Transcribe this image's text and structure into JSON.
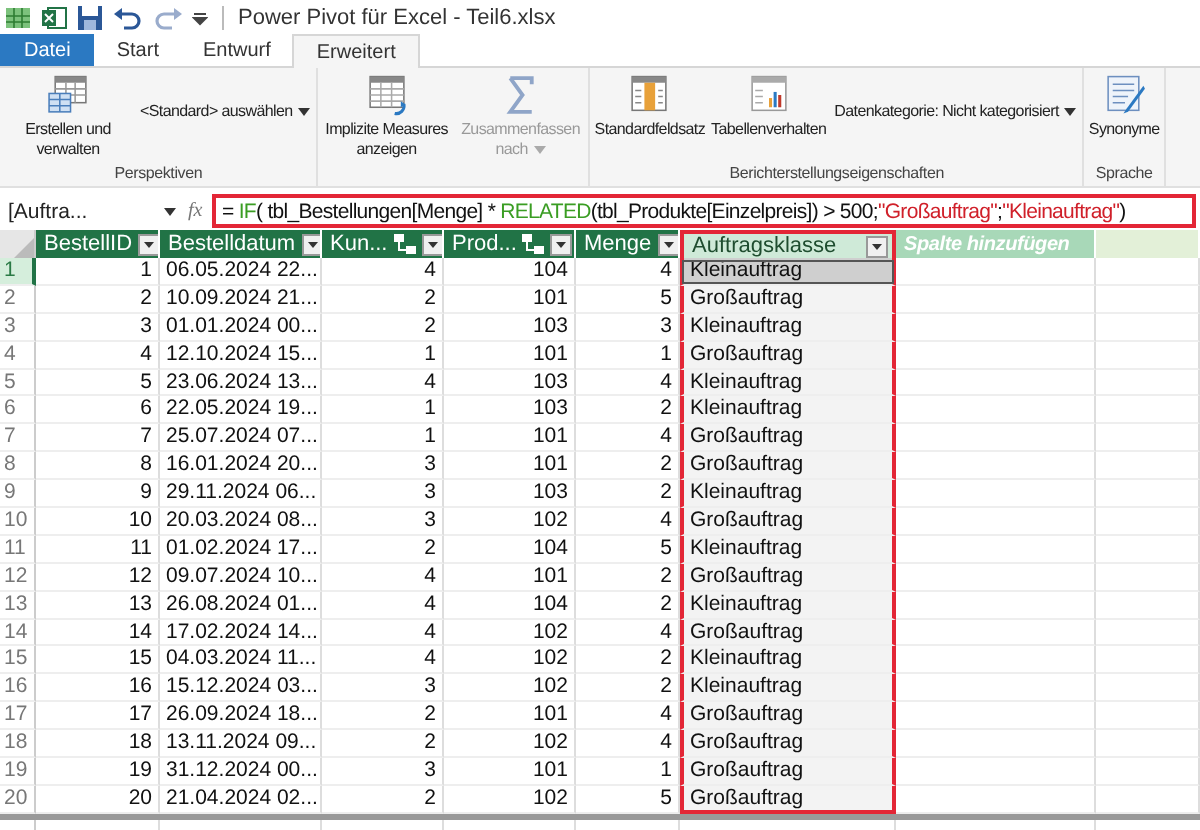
{
  "window": {
    "title": "Power Pivot für Excel - Teil6.xlsx"
  },
  "tabs": [
    {
      "label": "Datei",
      "kind": "file",
      "selected": false
    },
    {
      "label": "Start",
      "kind": "normal",
      "selected": false
    },
    {
      "label": "Entwurf",
      "kind": "normal",
      "selected": false
    },
    {
      "label": "Erweitert",
      "kind": "normal",
      "selected": true
    }
  ],
  "ribbon": {
    "groups": [
      {
        "title": "Perspektiven",
        "items": [
          {
            "kind": "large",
            "label": "Erstellen und verwalten",
            "disabled": false
          },
          {
            "kind": "dropdown",
            "label": "<Standard> auswählen"
          }
        ]
      },
      {
        "items": [
          {
            "kind": "large",
            "label": "Implizite Measures anzeigen",
            "disabled": false
          },
          {
            "kind": "large",
            "label": "Zusammenfassen nach",
            "disabled": true,
            "dropdown": true
          }
        ]
      },
      {
        "title": "Berichterstellungseigenschaften",
        "items": [
          {
            "kind": "large",
            "label": "Standardfeldsatz",
            "disabled": false
          },
          {
            "kind": "large",
            "label": "Tabellenverhalten",
            "disabled": false
          },
          {
            "kind": "dropdown",
            "label": "Datenkategorie: Nicht kategorisiert"
          }
        ]
      },
      {
        "title": "Sprache",
        "items": [
          {
            "kind": "large",
            "label": "Synonyme",
            "disabled": false
          }
        ]
      }
    ]
  },
  "formula_bar": {
    "name_box": "[Auftra...",
    "fx": "fx",
    "highlighted": true,
    "tokens": [
      {
        "text": "= ",
        "kind": "plain"
      },
      {
        "text": "IF",
        "kind": "function"
      },
      {
        "text": "( tbl_Bestellungen[Menge] * ",
        "kind": "plain"
      },
      {
        "text": "RELATED",
        "kind": "function"
      },
      {
        "text": "(tbl_Produkte[Einzelpreis]) > 500;",
        "kind": "plain"
      },
      {
        "text": "\"Großauftrag\"",
        "kind": "string"
      },
      {
        "text": ";",
        "kind": "plain"
      },
      {
        "text": "\"Kleinauftrag\"",
        "kind": "string"
      },
      {
        "text": ")",
        "kind": "plain"
      }
    ]
  },
  "table": {
    "columns": [
      {
        "label": "BestellID",
        "kind": "data",
        "relation": false,
        "selected": false
      },
      {
        "label": "Bestelldatum",
        "kind": "data",
        "relation": false,
        "selected": false
      },
      {
        "label": "Kun...",
        "kind": "data",
        "relation": true,
        "selected": false
      },
      {
        "label": "Prod...",
        "kind": "data",
        "relation": true,
        "selected": false
      },
      {
        "label": "Menge",
        "kind": "data",
        "relation": false,
        "selected": false
      },
      {
        "label": "Auftragsklasse",
        "kind": "calc",
        "relation": false,
        "selected": true
      },
      {
        "label": "Spalte hinzufügen",
        "kind": "add",
        "relation": false,
        "selected": false
      }
    ],
    "rows": [
      {
        "num": "1",
        "selected": true,
        "cells": [
          "1",
          "06.05.2024 22...",
          "4",
          "104",
          "4",
          "Kleinauftrag"
        ]
      },
      {
        "num": "2",
        "selected": false,
        "cells": [
          "2",
          "10.09.2024 21...",
          "2",
          "101",
          "5",
          "Großauftrag"
        ]
      },
      {
        "num": "3",
        "selected": false,
        "cells": [
          "3",
          "01.01.2024 00...",
          "2",
          "103",
          "3",
          "Kleinauftrag"
        ]
      },
      {
        "num": "4",
        "selected": false,
        "cells": [
          "4",
          "12.10.2024 15...",
          "1",
          "101",
          "1",
          "Großauftrag"
        ]
      },
      {
        "num": "5",
        "selected": false,
        "cells": [
          "5",
          "23.06.2024 13...",
          "4",
          "103",
          "4",
          "Kleinauftrag"
        ]
      },
      {
        "num": "6",
        "selected": false,
        "cells": [
          "6",
          "22.05.2024 19...",
          "1",
          "103",
          "2",
          "Kleinauftrag"
        ]
      },
      {
        "num": "7",
        "selected": false,
        "cells": [
          "7",
          "25.07.2024 07...",
          "1",
          "101",
          "4",
          "Großauftrag"
        ]
      },
      {
        "num": "8",
        "selected": false,
        "cells": [
          "8",
          "16.01.2024 20...",
          "3",
          "101",
          "2",
          "Großauftrag"
        ]
      },
      {
        "num": "9",
        "selected": false,
        "cells": [
          "9",
          "29.11.2024 06...",
          "3",
          "103",
          "2",
          "Kleinauftrag"
        ]
      },
      {
        "num": "10",
        "selected": false,
        "cells": [
          "10",
          "20.03.2024 08...",
          "3",
          "102",
          "4",
          "Großauftrag"
        ]
      },
      {
        "num": "11",
        "selected": false,
        "cells": [
          "11",
          "01.02.2024 17...",
          "2",
          "104",
          "5",
          "Kleinauftrag"
        ]
      },
      {
        "num": "12",
        "selected": false,
        "cells": [
          "12",
          "09.07.2024 10...",
          "4",
          "101",
          "2",
          "Großauftrag"
        ]
      },
      {
        "num": "13",
        "selected": false,
        "cells": [
          "13",
          "26.08.2024 01...",
          "4",
          "104",
          "2",
          "Kleinauftrag"
        ]
      },
      {
        "num": "14",
        "selected": false,
        "cells": [
          "14",
          "17.02.2024 14...",
          "4",
          "102",
          "4",
          "Großauftrag"
        ]
      },
      {
        "num": "15",
        "selected": false,
        "cells": [
          "15",
          "04.03.2024 11...",
          "4",
          "102",
          "2",
          "Kleinauftrag"
        ]
      },
      {
        "num": "16",
        "selected": false,
        "cells": [
          "16",
          "15.12.2024 03...",
          "3",
          "102",
          "2",
          "Kleinauftrag"
        ]
      },
      {
        "num": "17",
        "selected": false,
        "cells": [
          "17",
          "26.09.2024 18...",
          "2",
          "101",
          "4",
          "Großauftrag"
        ]
      },
      {
        "num": "18",
        "selected": false,
        "cells": [
          "18",
          "13.11.2024 09...",
          "2",
          "102",
          "4",
          "Großauftrag"
        ]
      },
      {
        "num": "19",
        "selected": false,
        "cells": [
          "19",
          "31.12.2024 00...",
          "3",
          "101",
          "1",
          "Großauftrag"
        ]
      },
      {
        "num": "20",
        "selected": false,
        "cells": [
          "20",
          "21.04.2024 02...",
          "2",
          "102",
          "5",
          "Großauftrag"
        ]
      }
    ]
  }
}
